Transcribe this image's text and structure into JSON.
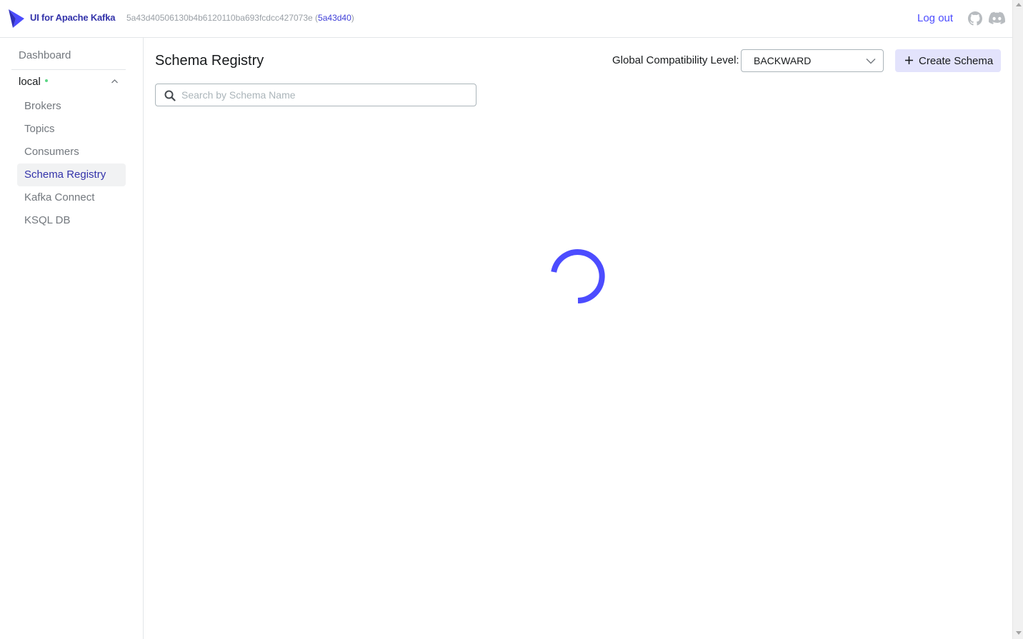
{
  "header": {
    "brand": "UI for Apache Kafka",
    "commit_full": "5a43d40506130b4b6120110ba693fcdcc427073e",
    "commit_open_paren": " (",
    "commit_short": "5a43d40",
    "commit_close_paren": ")",
    "logout_label": "Log out",
    "icons": [
      "kafka-logo-icon",
      "github-icon",
      "discord-icon"
    ]
  },
  "sidebar": {
    "dashboard_label": "Dashboard",
    "cluster_name": "local",
    "cluster_status_color": "#5cd685",
    "items": [
      {
        "label": "Brokers"
      },
      {
        "label": "Topics"
      },
      {
        "label": "Consumers"
      },
      {
        "label": "Schema Registry",
        "active": true
      },
      {
        "label": "Kafka Connect"
      },
      {
        "label": "KSQL DB"
      }
    ]
  },
  "main": {
    "title": "Schema Registry",
    "compatibility_label": "Global Compatibility Level:",
    "compatibility_value": "BACKWARD",
    "create_button_label": "Create Schema",
    "search_placeholder": "Search by Schema Name",
    "loading": true
  },
  "colors": {
    "accent": "#4c4cff",
    "brand": "#3333aa",
    "spinner": "#4c4cff",
    "button_bg": "#e3e3fc"
  }
}
